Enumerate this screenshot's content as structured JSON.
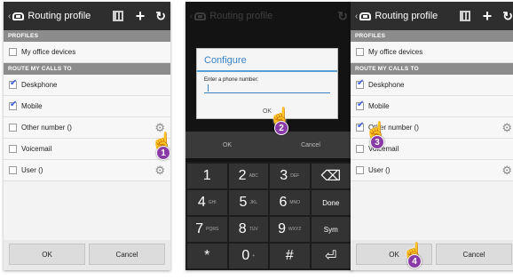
{
  "app_title": "Routing profile",
  "sections": {
    "profiles": "PROFILES",
    "route": "ROUTE MY CALLS TO"
  },
  "screen1": {
    "profile_item": "My office devices",
    "routes": [
      {
        "label": "Deskphone",
        "checked": true
      },
      {
        "label": "Mobile",
        "checked": true
      },
      {
        "label": "Other number ()",
        "checked": false
      },
      {
        "label": "Voicemail",
        "checked": false
      },
      {
        "label": "User ()",
        "checked": false
      }
    ],
    "ok": "OK",
    "cancel": "Cancel",
    "step": "1"
  },
  "screen2": {
    "dialog_title": "Configure",
    "dialog_label": "Enter a phone number:",
    "dialog_ok": "OK",
    "section_route": "ROUTE MY CALLS TO",
    "ok": "OK",
    "cancel": "Cancel",
    "keys": [
      {
        "main": "1",
        "sub": ""
      },
      {
        "main": "2",
        "sub": "ABC"
      },
      {
        "main": "3",
        "sub": "DEF"
      },
      {
        "main": "⌫",
        "sub": ""
      },
      {
        "main": "4",
        "sub": "GHI"
      },
      {
        "main": "5",
        "sub": "JKL"
      },
      {
        "main": "6",
        "sub": "MNO"
      },
      {
        "main": "Done",
        "sub": ""
      },
      {
        "main": "7",
        "sub": "PQRS"
      },
      {
        "main": "8",
        "sub": "TUV"
      },
      {
        "main": "9",
        "sub": "WXYZ"
      },
      {
        "main": "Sym",
        "sub": ""
      },
      {
        "main": "*",
        "sub": ""
      },
      {
        "main": "0",
        "sub": "+"
      },
      {
        "main": "#",
        "sub": ""
      },
      {
        "main": "⏎",
        "sub": ""
      }
    ],
    "step": "2"
  },
  "screen3": {
    "profile_item": "My office devices",
    "routes": [
      {
        "label": "Deskphone",
        "checked": true
      },
      {
        "label": "Mobile",
        "checked": true
      },
      {
        "label": "Other number ()",
        "checked": true
      },
      {
        "label": "Voicemail",
        "checked": false
      },
      {
        "label": "User ()",
        "checked": false
      }
    ],
    "ok": "OK",
    "cancel": "Cancel",
    "step3": "3",
    "step4": "4"
  },
  "colors": {
    "accent": "#3a82c6",
    "step_badge": "#8a3aa6",
    "actionbar": "#2e2e2e",
    "section": "#8c8c8c"
  }
}
